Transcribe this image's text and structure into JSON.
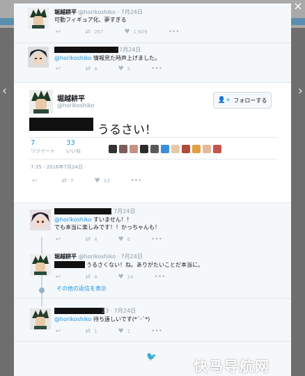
{
  "modal": {
    "close_icon": "×"
  },
  "tweets": {
    "t1": {
      "name": "堀越耕平",
      "handle": "@horikoshiko",
      "time": "· 7月24日",
      "text": "可動フィギュア化、夢すぎる",
      "retweets": "267",
      "likes": "1,609"
    },
    "t2": {
      "time": "· 7月24日",
      "mention": "@horikoshiko",
      "text": " 情報見た時声上げました。",
      "retweets": "4",
      "likes": "5"
    },
    "main": {
      "name": "堀越耕平",
      "handle": "@horikoshiko",
      "follow_label": "フォローする",
      "text": "うるさい！",
      "retweets_count": "7",
      "retweets_label": "リツイート",
      "likes_count": "33",
      "likes_label": "いいね",
      "timestamp": "7:35 - 2016年7月24日",
      "action_retweets": "7",
      "action_likes": "33"
    },
    "r1": {
      "time": "· 7月24日",
      "mention": "@horikoshiko",
      "line1": " すいません！！",
      "line2": "でも本当に楽しみです！！かっちゃんも！",
      "retweets": "4",
      "likes": "6"
    },
    "r2": {
      "name": "堀越耕平",
      "handle": "@horikoshiko · 7月24日",
      "text": "うるさくない！ね。ありがたいことだ本当に。",
      "retweets": "4",
      "likes": "24"
    },
    "more": "その他の返信を表示",
    "r3": {
      "time": "23 · 7月24日",
      "mention": "@horikoshiko",
      "text": " 待ち遠しいです(*ˊᵕˋ*)",
      "retweets": "1",
      "likes": "1"
    }
  },
  "watermark": "快马导航网",
  "colors": {
    "link": "#1b95e0",
    "muted": "#8899a6",
    "redaction": "#111111"
  }
}
